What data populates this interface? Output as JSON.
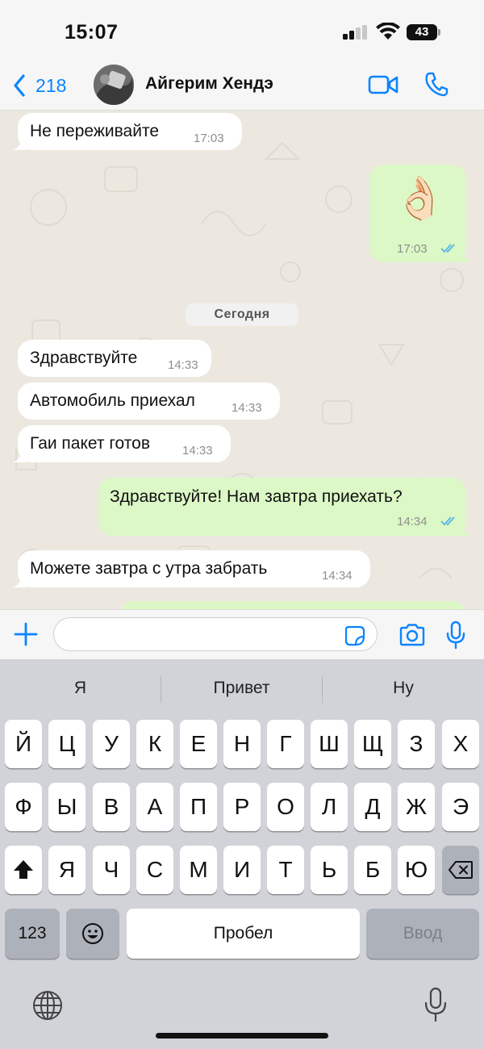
{
  "status_bar": {
    "time": "15:07",
    "battery_level": "43"
  },
  "header": {
    "back_count": "218",
    "contact_name": "Айгерим Хендэ"
  },
  "chat": {
    "date_divider": "Сегодня",
    "messages": [
      {
        "dir": "in",
        "text": "Не переживайте",
        "time": "17:03"
      },
      {
        "dir": "out",
        "emoji": "👌🏻",
        "time": "17:03",
        "status": "read"
      },
      {
        "dir": "in",
        "text": "Здравствуйте",
        "time": "14:33"
      },
      {
        "dir": "in",
        "text": "Автомобиль приехал",
        "time": "14:33"
      },
      {
        "dir": "in",
        "text": "Гаи пакет готов",
        "time": "14:33"
      },
      {
        "dir": "out",
        "text": "Здравствуйте! Нам завтра приехать?",
        "time": "14:34",
        "status": "read"
      },
      {
        "dir": "in",
        "text": "Можете завтра с утра забрать",
        "time": "14:34"
      }
    ]
  },
  "input": {
    "value": "",
    "placeholder": ""
  },
  "keyboard": {
    "suggestions": [
      "Я",
      "Привет",
      "Ну"
    ],
    "row1": [
      "Й",
      "Ц",
      "У",
      "К",
      "Е",
      "Н",
      "Г",
      "Ш",
      "Щ",
      "З",
      "Х"
    ],
    "row2": [
      "Ф",
      "Ы",
      "В",
      "А",
      "П",
      "Р",
      "О",
      "Л",
      "Д",
      "Ж",
      "Э"
    ],
    "row3": [
      "Я",
      "Ч",
      "С",
      "М",
      "И",
      "Т",
      "Ь",
      "Б",
      "Ю"
    ],
    "numbers_label": "123",
    "space_label": "Пробел",
    "return_label": "Ввод"
  },
  "colors": {
    "accent": "#0a84ff",
    "incoming_bubble": "#ffffff",
    "outgoing_bubble": "#dcf8c6",
    "chat_background": "#ece8e0",
    "read_ticks": "#4fb6ec"
  },
  "icons": {
    "back": "chevron-left-icon",
    "video": "video-camera-icon",
    "call": "phone-icon",
    "attach": "plus-icon",
    "sticker": "sticker-icon",
    "camera": "camera-icon",
    "mic": "microphone-icon",
    "shift": "shift-icon",
    "delete": "backspace-icon",
    "emoji": "emoji-icon",
    "globe": "globe-icon",
    "dictation": "microphone-icon"
  }
}
